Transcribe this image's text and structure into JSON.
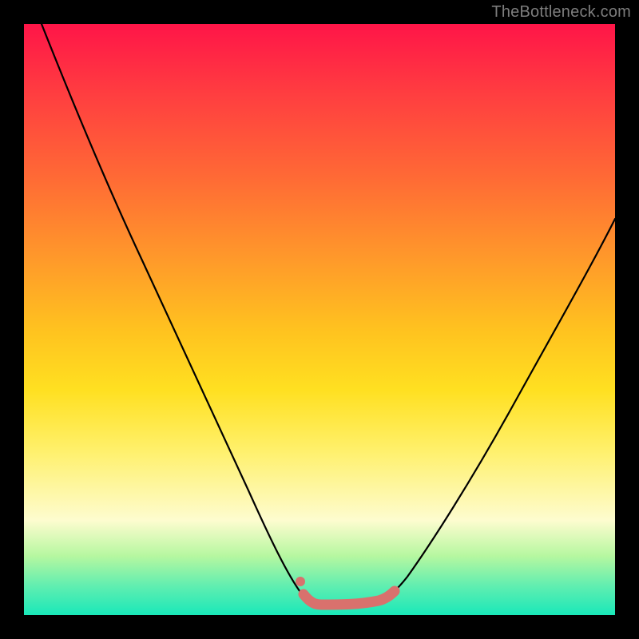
{
  "watermark": "TheBottleneck.com",
  "chart_data": {
    "type": "line",
    "title": "",
    "xlabel": "",
    "ylabel": "",
    "xlim": [
      0,
      1
    ],
    "ylim": [
      0,
      1
    ],
    "series": [
      {
        "name": "bottleneck-curve",
        "x": [
          0.03,
          0.08,
          0.14,
          0.2,
          0.26,
          0.32,
          0.38,
          0.43,
          0.47,
          0.5,
          0.54,
          0.58,
          0.62,
          0.66,
          0.72,
          0.79,
          0.86,
          0.93,
          1.0
        ],
        "values": [
          1.0,
          0.87,
          0.73,
          0.6,
          0.47,
          0.34,
          0.22,
          0.12,
          0.05,
          0.02,
          0.02,
          0.02,
          0.04,
          0.09,
          0.18,
          0.3,
          0.43,
          0.55,
          0.67
        ]
      },
      {
        "name": "highlight-segment",
        "x": [
          0.47,
          0.5,
          0.54,
          0.58,
          0.62
        ],
        "values": [
          0.04,
          0.02,
          0.02,
          0.02,
          0.035
        ]
      }
    ],
    "annotations": [
      {
        "name": "highlight-start-dot",
        "x": 0.47,
        "y": 0.06
      }
    ],
    "background_gradient": {
      "top": "#ff1548",
      "mid": "#ffe021",
      "bottom": "#19e8b9"
    },
    "colors": {
      "curve": "#000000",
      "highlight": "#d9716d",
      "frame": "#000000"
    }
  }
}
